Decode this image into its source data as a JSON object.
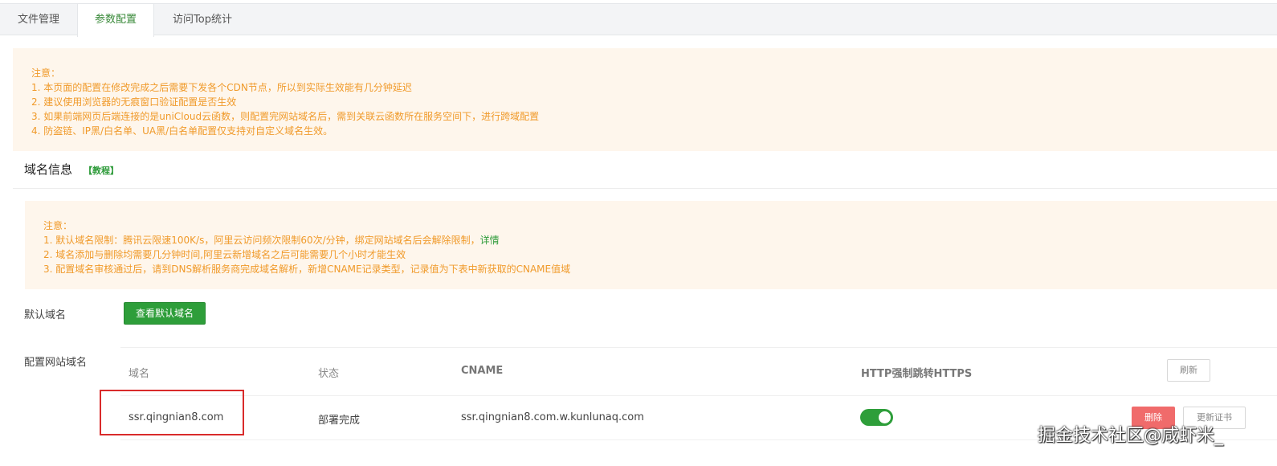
{
  "tabs": [
    "文件管理",
    "参数配置",
    "访问Top统计"
  ],
  "notice1": {
    "title": "注意：",
    "lines": [
      "1. 本页面的配置在修改完成之后需要下发各个CDN节点，所以到实际生效能有几分钟延迟",
      "2. 建议使用浏览器的无痕窗口验证配置是否生效",
      "3. 如果前端网页后端连接的是uniCloud云函数，则配置完网站域名后，需到关联云函数所在服务空间下，进行跨域配置",
      "4. 防盗链、IP黑/白名单、UA黑/白名单配置仅支持对自定义域名生效。"
    ]
  },
  "domain_section": {
    "title": "域名信息",
    "tutorial_link": "【教程】"
  },
  "notice2": {
    "title": "注意：",
    "line1_prefix": "1. 默认域名限制：腾讯云限速100K/s，阿里云访问频次限制60次/分钟，绑定网站域名后会解除限制，",
    "line1_link": "详情",
    "line2": "2. 域名添加与删除均需要几分钟时间,阿里云新增域名之后可能需要几个小时才能生效",
    "line3": "3. 配置域名审核通过后，请到DNS解析服务商完成域名解析，新增CNAME记录类型，记录值为下表中新获取的CNAME值域"
  },
  "default_domain": {
    "label": "默认域名",
    "button": "查看默认域名"
  },
  "site_domain": {
    "label": "配置网站域名",
    "headers": {
      "domain": "域名",
      "status": "状态",
      "cname": "CNAME",
      "https": "HTTP强制跳转HTTPS"
    },
    "refresh_button": "刷新",
    "rows": [
      {
        "domain": "ssr.qingnian8.com",
        "status": "部署完成",
        "cname": "ssr.qingnian8.com.w.kunlunaq.com",
        "https_enabled": true,
        "delete_button": "删除",
        "update_cert_button": "更新证书"
      }
    ]
  },
  "watermark": "掘金技术社区@咸虾米_",
  "colors": {
    "accent_green": "#2e9e3a",
    "notice_text": "#f09a2a",
    "notice_bg": "#fef6ec",
    "delete_red": "#f06b6b",
    "highlight_red": "#d92b2b"
  }
}
